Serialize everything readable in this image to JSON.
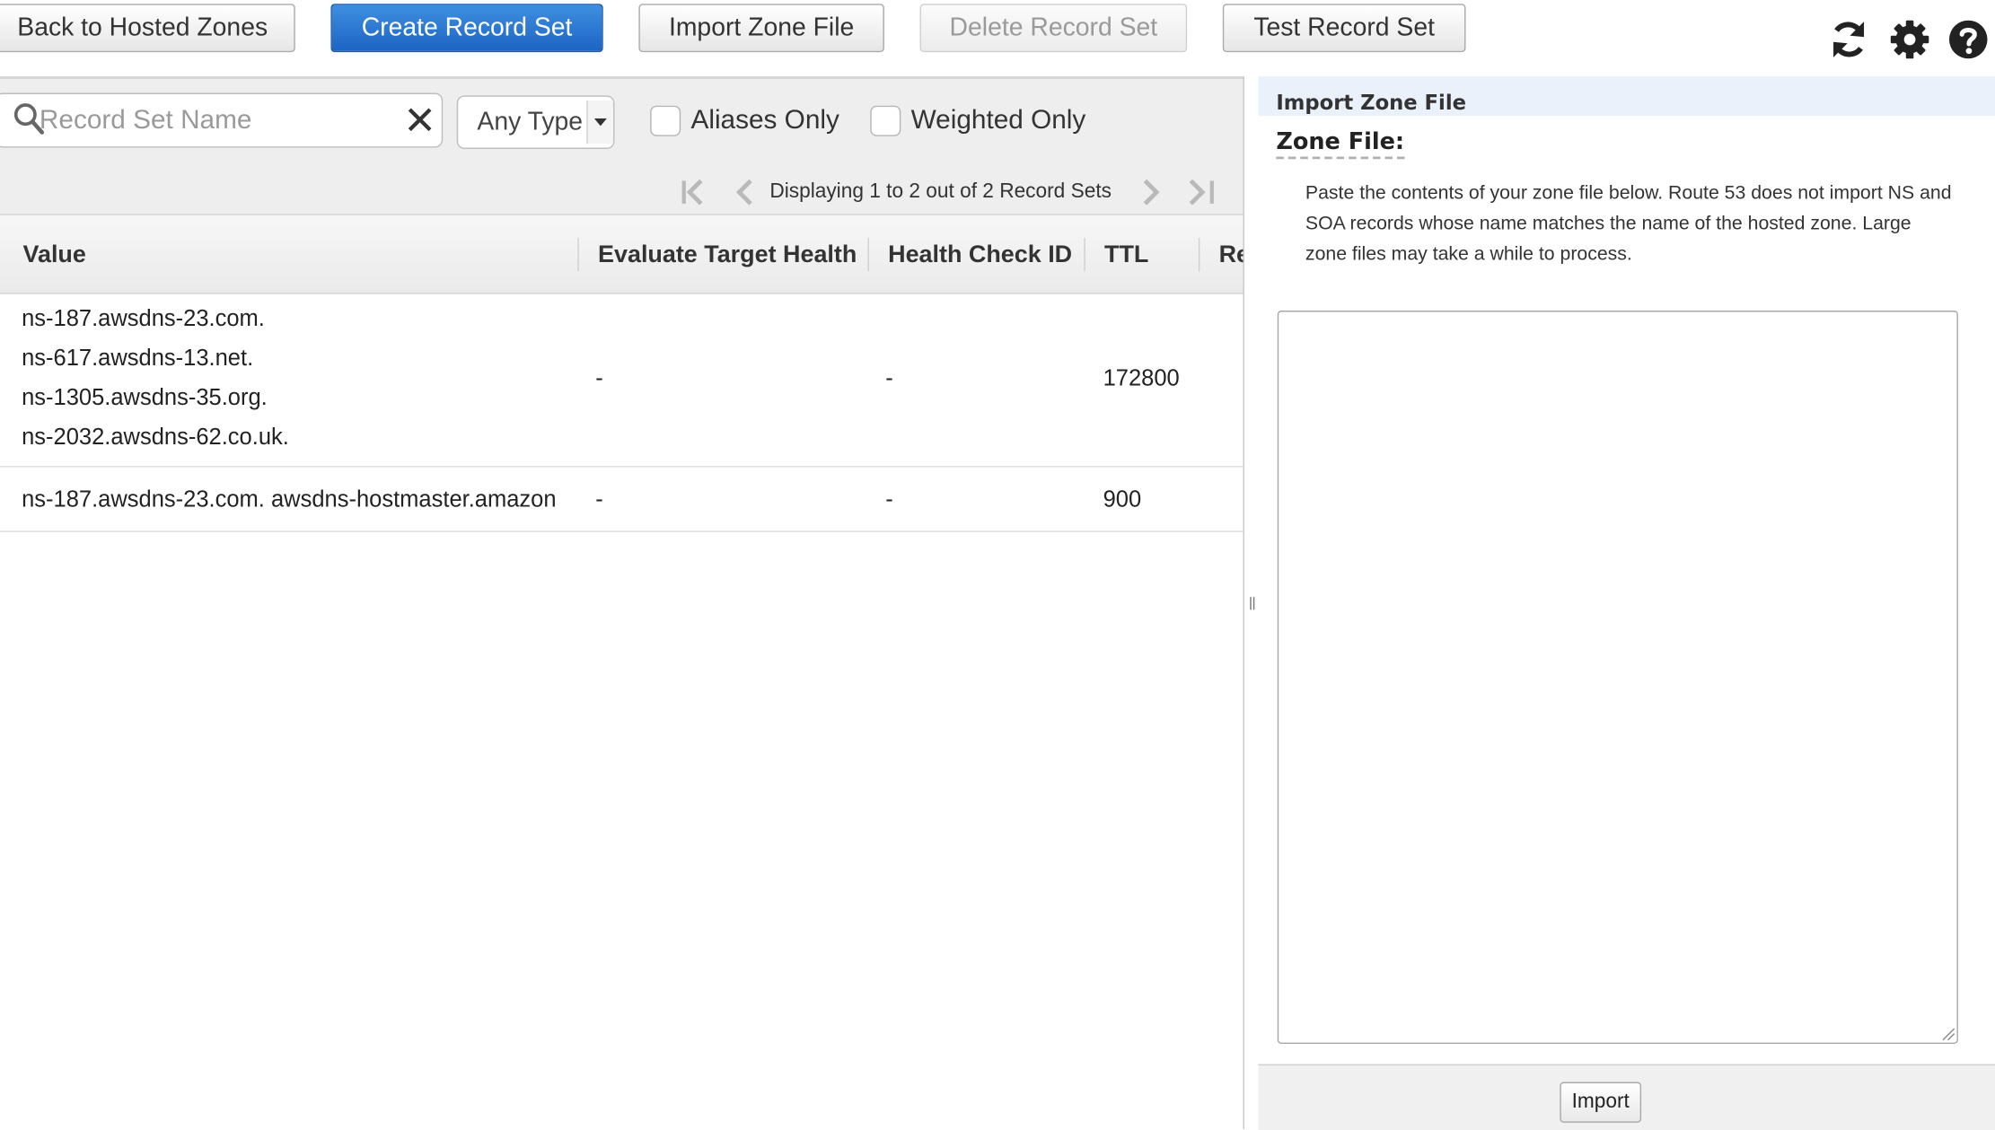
{
  "toolbar": {
    "back_label": "Back to Hosted Zones",
    "create_label": "Create Record Set",
    "import_label": "Import Zone File",
    "delete_label": "Delete Record Set",
    "test_label": "Test Record Set",
    "icons": [
      "refresh-icon",
      "gear-icon",
      "help-icon"
    ]
  },
  "filters": {
    "search_placeholder": "Record Set Name",
    "search_value": "",
    "type_value": "Any Type",
    "aliases_only_label": "Aliases Only",
    "aliases_only_checked": false,
    "weighted_only_label": "Weighted Only",
    "weighted_only_checked": false
  },
  "pager": {
    "text": "Displaying 1 to 2 out of 2 Record Sets"
  },
  "table": {
    "columns": [
      "Value",
      "Evaluate Target Health",
      "Health Check ID",
      "TTL",
      "Re"
    ],
    "rows": [
      {
        "value_lines": [
          "ns-187.awsdns-23.com.",
          "ns-617.awsdns-13.net.",
          "ns-1305.awsdns-35.org.",
          "ns-2032.awsdns-62.co.uk."
        ],
        "evaluate_target_health": "-",
        "health_check_id": "-",
        "ttl": "172800"
      },
      {
        "value_lines": [
          "ns-187.awsdns-23.com. awsdns-hostmaster.amazon"
        ],
        "evaluate_target_health": "-",
        "health_check_id": "-",
        "ttl": "900"
      }
    ]
  },
  "import_panel": {
    "title": "Import Zone File",
    "zone_file_label": "Zone File:",
    "description": "Paste the contents of your zone file below. Route 53 does not import NS and SOA records whose name matches the name of the hosted zone. Large zone files may take a while to process.",
    "textarea_value": "",
    "import_button": "Import"
  },
  "colors": {
    "primary_button": "#1d64c4",
    "panel_header": "#eaf1fa"
  }
}
